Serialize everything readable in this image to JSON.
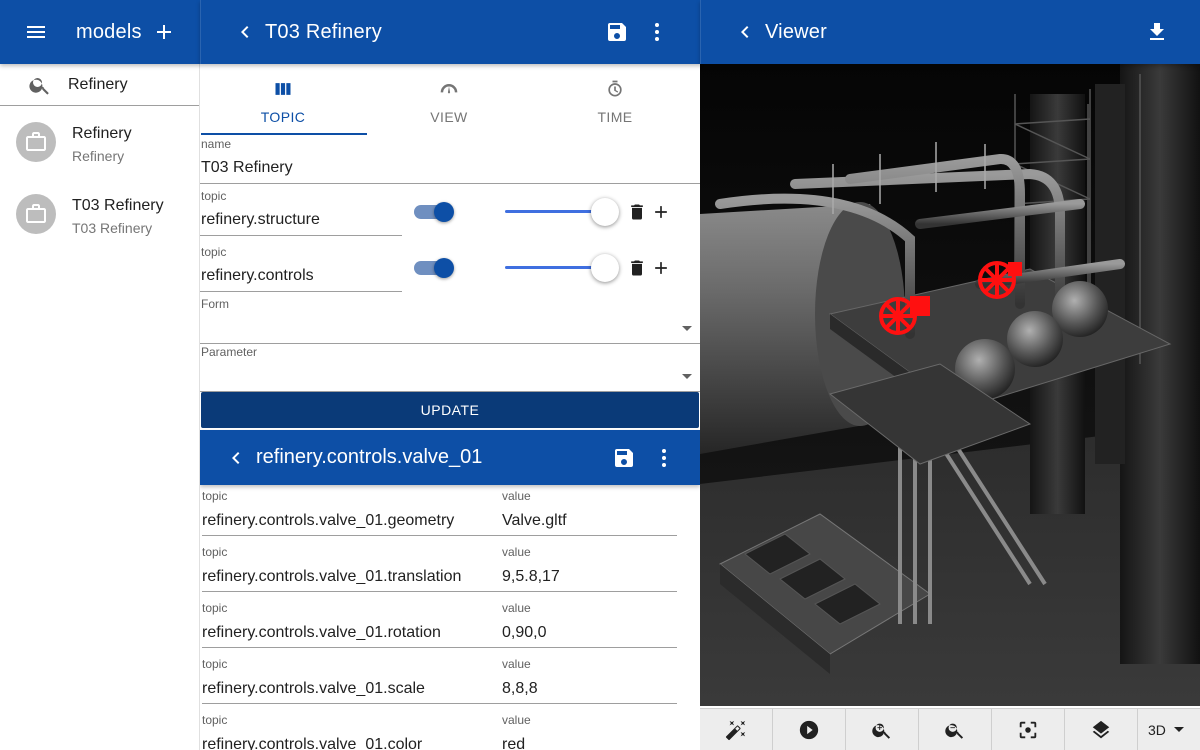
{
  "left_bar": {
    "title": "models"
  },
  "search": {
    "value": "Refinery"
  },
  "models": [
    {
      "name": "Refinery",
      "subtitle": "Refinery"
    },
    {
      "name": "T03 Refinery",
      "subtitle": "T03 Refinery"
    }
  ],
  "editor_bar": {
    "title": "T03 Refinery"
  },
  "viewer_bar": {
    "title": "Viewer"
  },
  "tabs": [
    {
      "label": "TOPIC",
      "icon": "columns-icon",
      "active": true
    },
    {
      "label": "VIEW",
      "icon": "gauge-icon",
      "active": false
    },
    {
      "label": "TIME",
      "icon": "clock-icon",
      "active": false
    }
  ],
  "form": {
    "name_label": "name",
    "name_value": "T03 Refinery",
    "topics": [
      {
        "label": "topic",
        "value": "refinery.structure",
        "enabled": true,
        "slider": 1.0
      },
      {
        "label": "topic",
        "value": "refinery.controls",
        "enabled": true,
        "slider": 1.0
      }
    ],
    "form_label": "Form",
    "parameter_label": "Parameter",
    "update_label": "UPDATE"
  },
  "sub_bar": {
    "title": "refinery.controls.valve_01"
  },
  "properties": [
    {
      "topic_label": "topic",
      "topic": "refinery.controls.valve_01.geometry",
      "value_label": "value",
      "value": "Valve.gltf"
    },
    {
      "topic_label": "topic",
      "topic": "refinery.controls.valve_01.translation",
      "value_label": "value",
      "value": "9,5.8,17"
    },
    {
      "topic_label": "topic",
      "topic": "refinery.controls.valve_01.rotation",
      "value_label": "value",
      "value": "0,90,0"
    },
    {
      "topic_label": "topic",
      "topic": "refinery.controls.valve_01.scale",
      "value_label": "value",
      "value": "8,8,8"
    },
    {
      "topic_label": "topic",
      "topic": "refinery.controls.valve_01.color",
      "value_label": "value",
      "value": "red"
    }
  ],
  "viewer_toolbar": {
    "tools": [
      "magic-wand-icon",
      "play-icon",
      "zoom-in-icon",
      "zoom-out-icon",
      "center-focus-icon",
      "layers-icon"
    ],
    "mode": "3D"
  },
  "colors": {
    "primary": "#0d4fa6",
    "primary_dark": "#0a3a78",
    "valve": "#ff1010"
  }
}
